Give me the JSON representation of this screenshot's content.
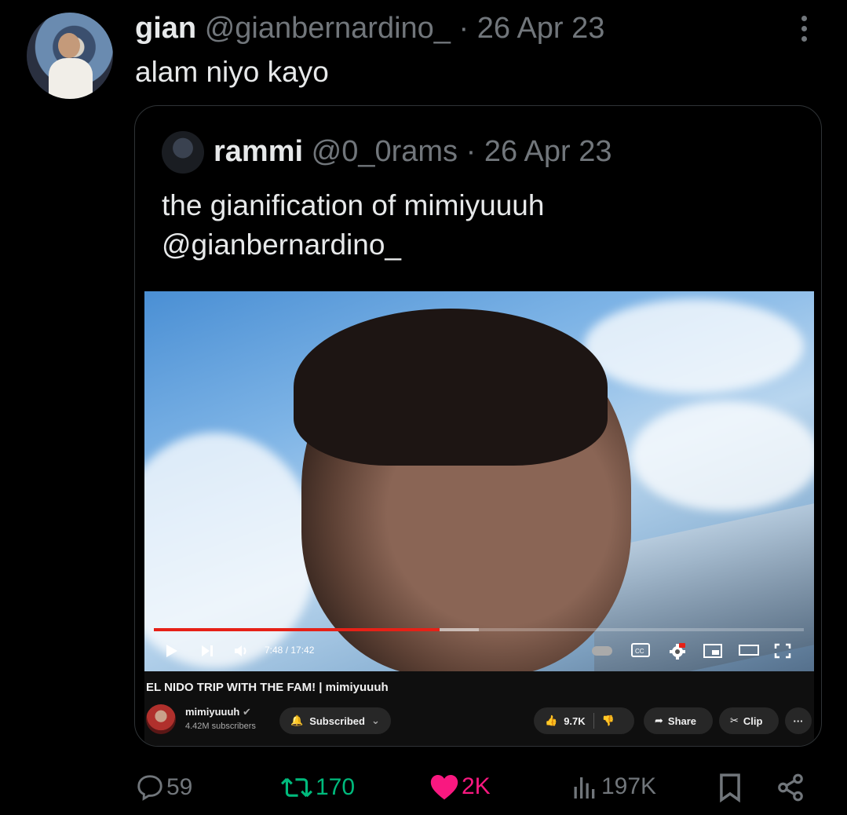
{
  "tweet": {
    "name": "gian",
    "handle": "@gianbernardino_",
    "separator": "·",
    "date": "26 Apr 23",
    "text": "alam niyo kayo"
  },
  "quote": {
    "name": "rammi",
    "handle": "@0_0rams",
    "separator": "·",
    "date": "26 Apr 23",
    "text_line1": "the gianification of mimiyuuuh",
    "text_line2": "@gianbernardino_"
  },
  "video": {
    "time": "7:48 / 17:42",
    "progress_played": 0.44,
    "progress_buffered": 0.5,
    "title": "EL NIDO TRIP WITH THE FAM! | mimiyuuuh",
    "channel_name": "mimiyuuuh",
    "channel_subs": "4.42M subscribers",
    "subscribe_label": "Subscribed",
    "likes": "9.7K",
    "share_label": "Share",
    "clip_label": "Clip",
    "more_label": "···"
  },
  "actions": {
    "replies": "59",
    "retweets": "170",
    "likes": "2K",
    "views": "197K"
  },
  "colors": {
    "background": "#000000",
    "text": "#e7e9ea",
    "muted": "#71767b",
    "retweet": "#00ba7c",
    "like": "#f91880",
    "border": "#2f3336",
    "yt_red": "#e62117"
  }
}
